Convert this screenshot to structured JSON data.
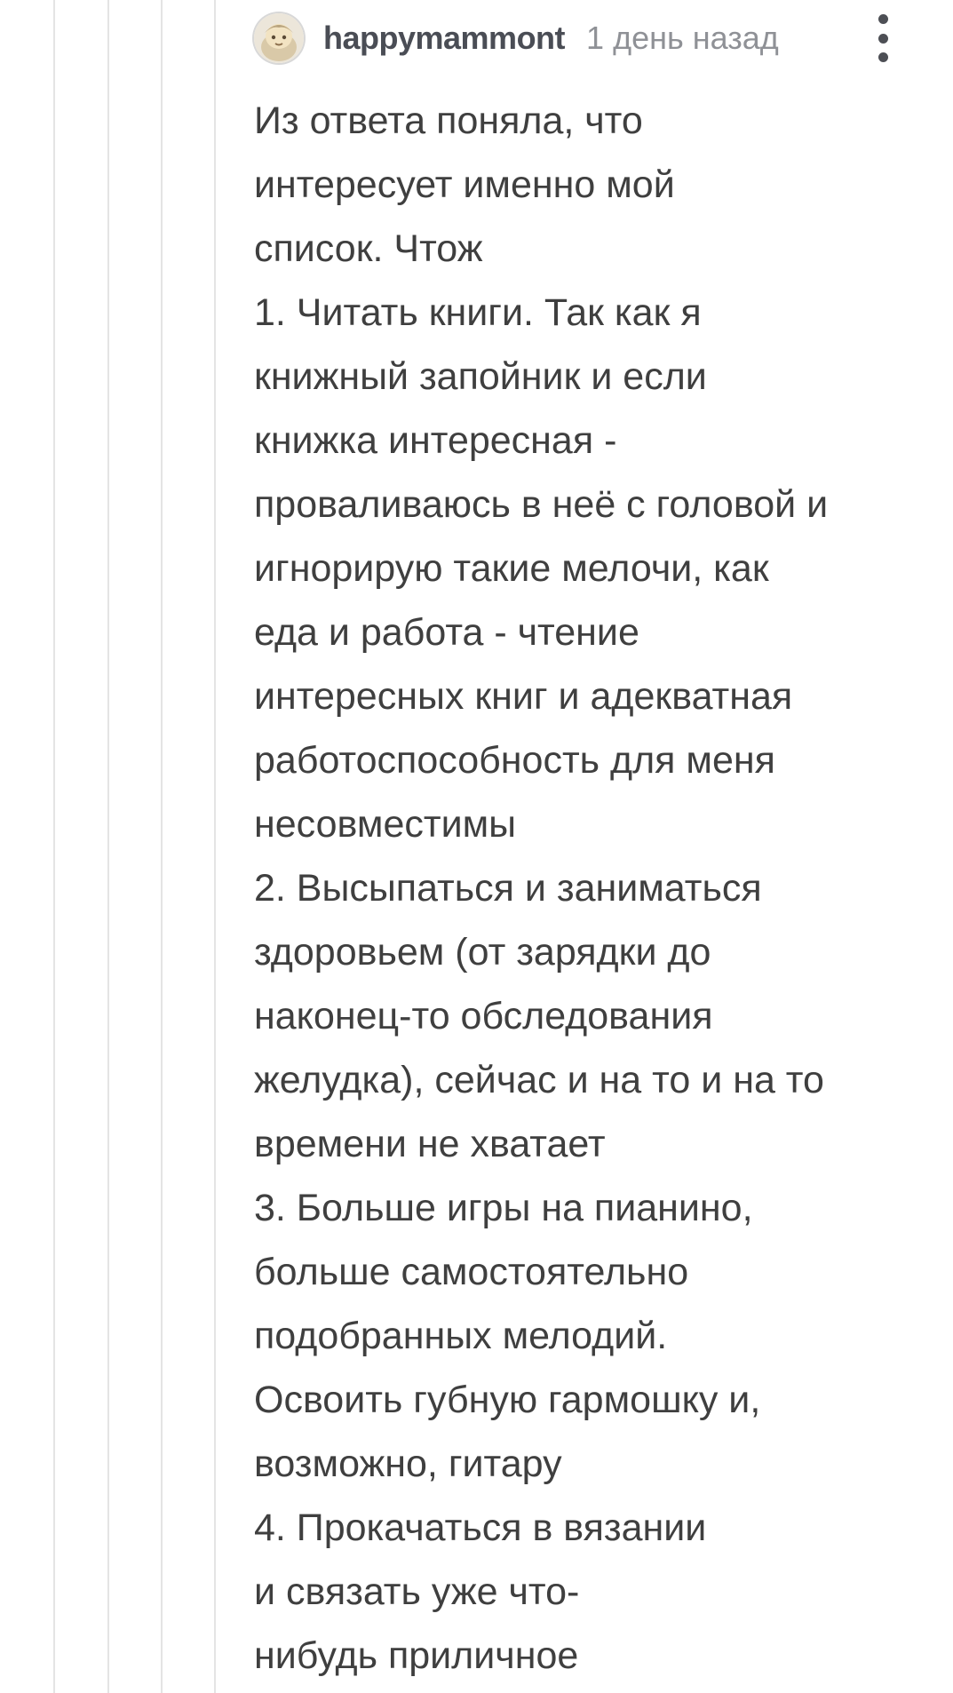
{
  "comment": {
    "username": "happymammont",
    "timestamp": "1 день назад",
    "body_lines": [
      "Из ответа поняла, что",
      "интересует именно мой",
      "список. Чтож",
      "1. Читать книги. Так как я",
      "книжный запойник и если",
      "книжка интересная -",
      "проваливаюсь в неё с головой и",
      "игнорирую такие мелочи, как",
      "еда и работа - чтение",
      "интересных книг и адекватная",
      "работоспособность для меня",
      "несовместимы",
      "2. Высыпаться и заниматься",
      "здоровьем (от зарядки до",
      "наконец-то обследования",
      "желудка), сейчас и на то и на то",
      "времени не хватает",
      "3. Больше игры на пианино,",
      "больше самостоятельно",
      "подобранных мелодий.",
      "Освоить губную гармошку и,",
      "возможно, гитару",
      "4. Прокачаться в вязании",
      "и связать уже что-",
      "нибудь приличное"
    ]
  },
  "icons": {
    "avatar": "avatar-icon",
    "more": "more-vertical-icon"
  },
  "colors": {
    "thread_line": "#e4e4e4",
    "username": "#4a4d55",
    "timestamp": "#8f9196",
    "body_text": "#3f3f3f"
  }
}
